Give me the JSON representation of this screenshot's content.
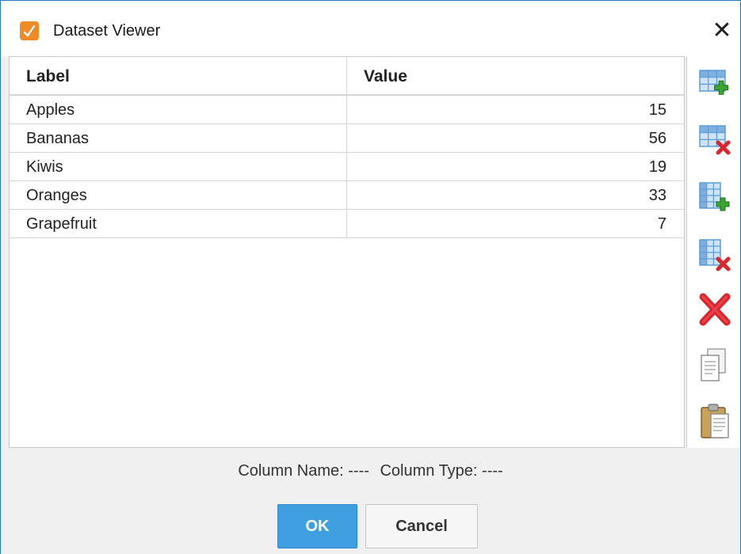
{
  "window": {
    "title": "Dataset Viewer",
    "close_glyph": "✕",
    "app_icon": "dataset-viewer-app-icon"
  },
  "table": {
    "columns": [
      "Label",
      "Value"
    ],
    "rows": [
      {
        "label": "Apples",
        "value": "15"
      },
      {
        "label": "Bananas",
        "value": "56"
      },
      {
        "label": "Kiwis",
        "value": "19"
      },
      {
        "label": "Oranges",
        "value": "33"
      },
      {
        "label": "Grapefruit",
        "value": "7"
      }
    ]
  },
  "toolbar": {
    "tools": [
      "add-column-icon",
      "remove-column-icon",
      "add-row-icon",
      "remove-row-icon",
      "delete-icon",
      "copy-icon",
      "paste-icon"
    ]
  },
  "status": {
    "column_name": "Column Name: ----",
    "column_type": "Column Type: ----"
  },
  "buttons": {
    "ok": "OK",
    "cancel": "Cancel"
  },
  "colors": {
    "accent": "#3f9fe0",
    "delete_red": "#d9262c",
    "add_green": "#3aa52f",
    "grid_blue": "#5b9bd5"
  }
}
